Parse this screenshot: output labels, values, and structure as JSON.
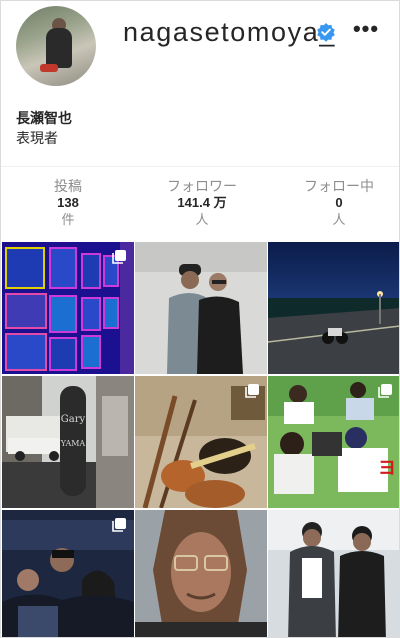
{
  "profile": {
    "username": "nagasetomoya_",
    "display_name": "長瀬智也",
    "bio": "表現者",
    "verified_icon": "verified-badge-icon",
    "more_icon": "more-options-icon",
    "more_label": "•••"
  },
  "stats": [
    {
      "label": "投稿",
      "value": "138",
      "unit": "件"
    },
    {
      "label": "フォロワー",
      "value": "141.4 万",
      "unit": "人"
    },
    {
      "label": "フォロー中",
      "value": "0",
      "unit": "人"
    }
  ],
  "colors": {
    "verified": "#3897f0",
    "text_primary": "#262626",
    "text_secondary": "#8e8e8e",
    "border": "#dbdbdb"
  },
  "posts": [
    {
      "content": "neon-art-wall",
      "multi": true
    },
    {
      "content": "two-men-portrait",
      "multi": false
    },
    {
      "content": "motorcycle-night-road",
      "multi": false
    },
    {
      "content": "skateboard-storefront",
      "multi": false
    },
    {
      "content": "guitar-collection",
      "multi": true
    },
    {
      "content": "group-working-on-bike",
      "multi": true
    },
    {
      "content": "group-photo-bar",
      "multi": true
    },
    {
      "content": "selfie-sunglasses",
      "multi": false
    },
    {
      "content": "two-men-outdoors",
      "multi": false
    }
  ]
}
